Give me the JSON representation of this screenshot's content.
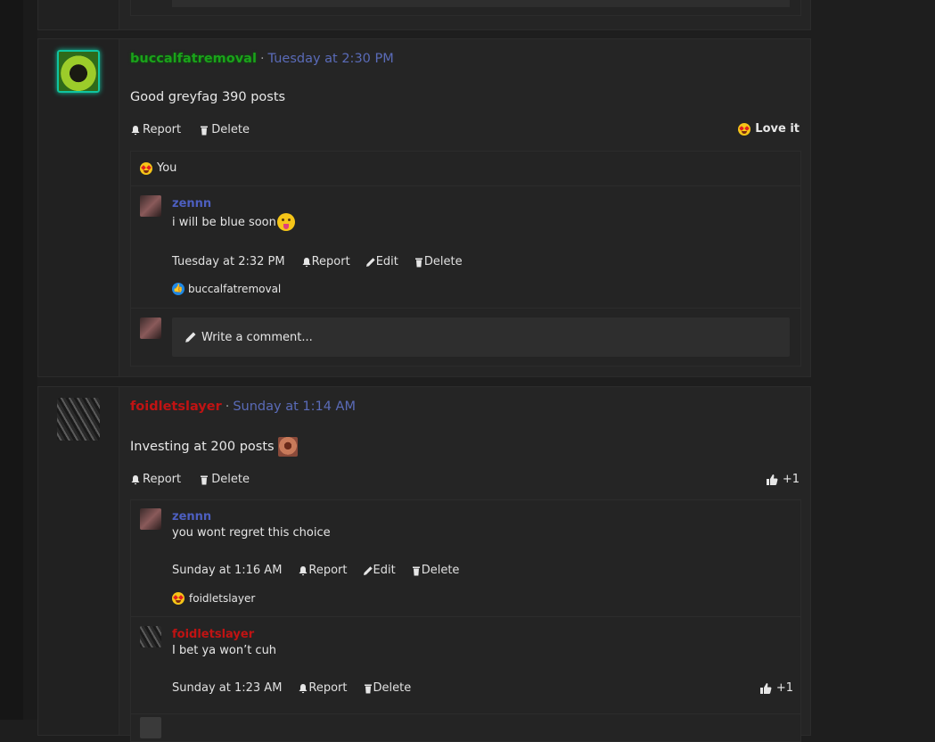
{
  "colors": {
    "background": "#1e1e1e",
    "link_blue": "#5a6bb8",
    "red_user": "#c01313",
    "green_user": "#1aa31a"
  },
  "post1": {
    "author": "buccalfatremoval",
    "time": "Tuesday at 2:30 PM",
    "text": "Good greyfag 390 posts",
    "actions": {
      "report": "Report",
      "delete": "Delete"
    },
    "reaction_label": "Love it",
    "reactions_summary": {
      "emoji": "star-struck-emoji",
      "text": "You"
    },
    "comment": {
      "author": "zennn",
      "text": "i will be blue soon",
      "emoji": "tongue-out-emoji",
      "time": "Tuesday at 2:32 PM",
      "actions": {
        "report": "Report",
        "edit": "Edit",
        "delete": "Delete"
      },
      "reaction": {
        "icon": "like-icon",
        "user": "buccalfatremoval"
      }
    },
    "write_comment": "Write a comment..."
  },
  "post2": {
    "author": "foidletslayer",
    "time": "Sunday at 1:14 AM",
    "text": "Investing at 200 posts",
    "actions": {
      "report": "Report",
      "delete": "Delete"
    },
    "reaction_count": "+1",
    "comments": [
      {
        "author": "zennn",
        "text": "you wont regret this choice",
        "time": "Sunday at 1:16 AM",
        "actions": {
          "report": "Report",
          "edit": "Edit",
          "delete": "Delete"
        },
        "reaction": {
          "icon": "star-struck-emoji",
          "user": "foidletslayer"
        }
      },
      {
        "author": "foidletslayer",
        "text": "I bet ya won’t cuh",
        "time": "Sunday at 1:23 AM",
        "actions": {
          "report": "Report",
          "delete": "Delete"
        },
        "reaction_count": "+1"
      }
    ]
  }
}
